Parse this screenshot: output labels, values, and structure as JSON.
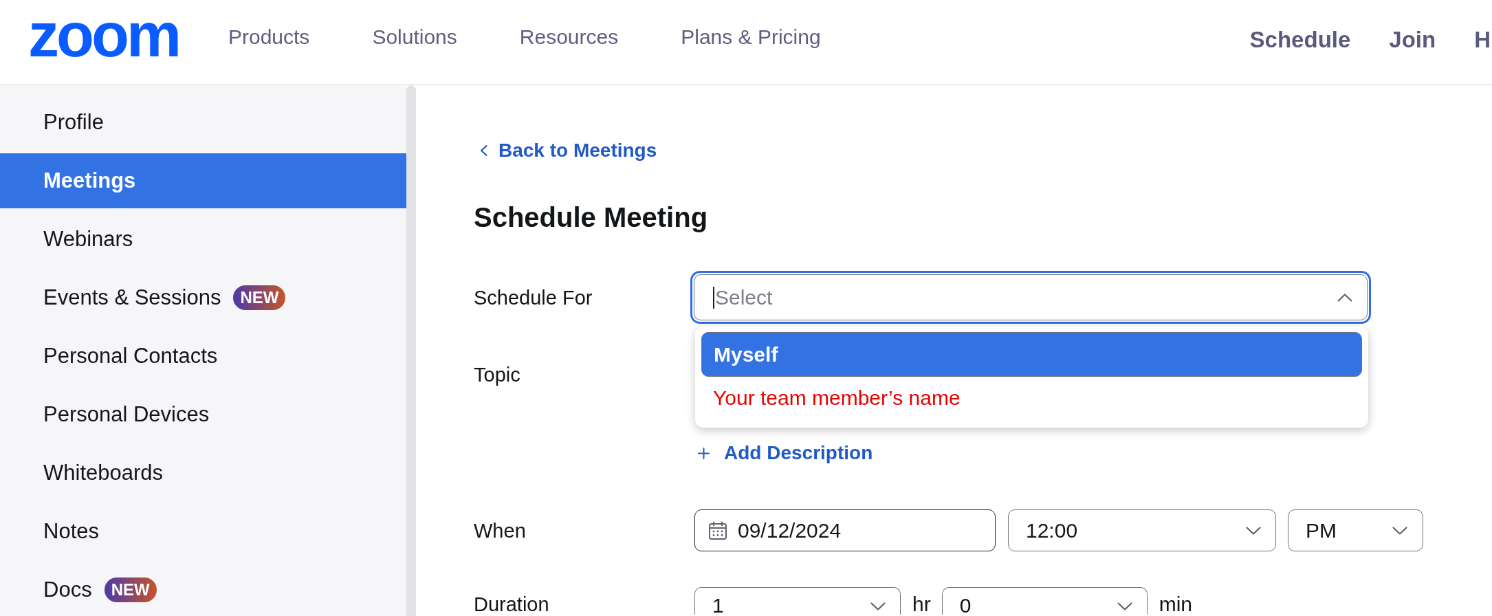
{
  "header": {
    "logo": "zoom",
    "nav": [
      "Products",
      "Solutions",
      "Resources",
      "Plans & Pricing"
    ],
    "actions": [
      "Schedule",
      "Join",
      "H"
    ]
  },
  "sidebar": {
    "items": [
      {
        "label": "Profile",
        "selected": false
      },
      {
        "label": "Meetings",
        "selected": true
      },
      {
        "label": "Webinars",
        "selected": false
      },
      {
        "label": "Events & Sessions",
        "selected": false,
        "badge": "NEW"
      },
      {
        "label": "Personal Contacts",
        "selected": false
      },
      {
        "label": "Personal Devices",
        "selected": false
      },
      {
        "label": "Whiteboards",
        "selected": false
      },
      {
        "label": "Notes",
        "selected": false
      },
      {
        "label": "Docs",
        "selected": false,
        "badge": "NEW"
      }
    ]
  },
  "main": {
    "back_link": "Back to Meetings",
    "title": "Schedule Meeting",
    "schedule_for": {
      "label": "Schedule For",
      "placeholder": "Select",
      "expanded": true,
      "options": [
        {
          "label": "Myself",
          "selected": true
        },
        {
          "label": "Your team member’s name",
          "selected": false,
          "color": "#e60000"
        }
      ]
    },
    "topic": {
      "label": "Topic"
    },
    "add_description": "Add Description",
    "when": {
      "label": "When",
      "date": "09/12/2024",
      "time": "12:00",
      "period": "PM"
    },
    "duration": {
      "label": "Duration",
      "hours": "1",
      "hours_unit": "hr",
      "minutes": "0",
      "minutes_unit": "min"
    }
  }
}
